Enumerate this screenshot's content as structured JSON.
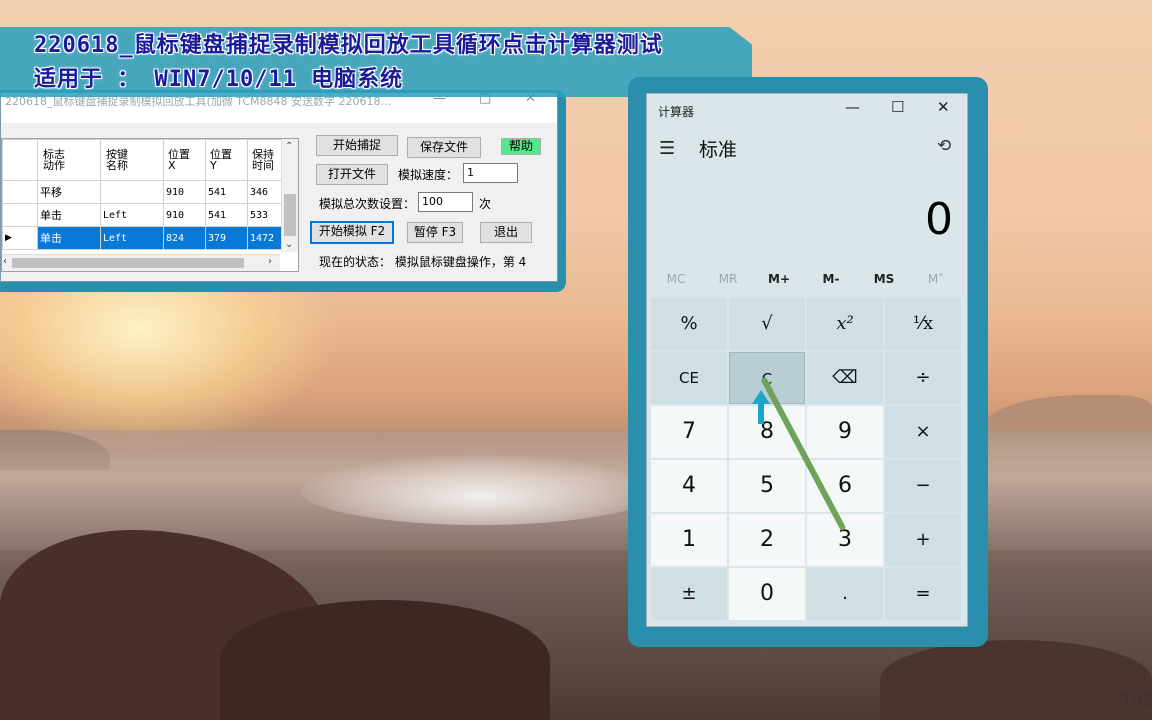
{
  "banner": {
    "line1": "220618_鼠标键盘捕捉录制模拟回放工具循环点击计算器测试",
    "line2": "适用于 ： WIN7/10/11 电脑系统"
  },
  "recorder": {
    "title": "220618_鼠标键盘捕捉录制模拟回放工具(加微 TCM8848 安送数字 220618...",
    "title_controls": [
      "—",
      "□",
      "✕"
    ],
    "headers": [
      "",
      "标志\n动作",
      "按键\n名称",
      "位置\nX",
      "位置\nY",
      "保持\n时间"
    ],
    "rows": [
      {
        "action": "平移",
        "key": "",
        "x": "910",
        "y": "541",
        "hold": "346"
      },
      {
        "action": "单击",
        "key": "Left",
        "x": "910",
        "y": "541",
        "hold": "533"
      },
      {
        "action": "单击",
        "key": "Left",
        "x": "824",
        "y": "379",
        "hold": "1472"
      }
    ],
    "buttons": {
      "start_capture": "开始捕捉",
      "save_file": "保存文件",
      "help": "帮助",
      "open_file": "打开文件",
      "start_sim": "开始模拟 F2",
      "pause": "暂停 F3",
      "exit": "退出"
    },
    "speed_label": "模拟速度：",
    "speed_value": "1",
    "total_label": "模拟总次数设置：",
    "total_value": "100",
    "total_unit": "次",
    "status": "现在的状态：  模拟鼠标键盘操作，第 4"
  },
  "calculator": {
    "app_title": "计算器",
    "window_controls": [
      "—",
      "☐",
      "✕"
    ],
    "mode": "标准",
    "display": "0",
    "memory": [
      "MC",
      "MR",
      "M+",
      "M-",
      "MS",
      "M˅"
    ],
    "keys": [
      [
        "%",
        "√",
        "x²",
        "¹⁄x"
      ],
      [
        "CE",
        "C",
        "⌫",
        "÷"
      ],
      [
        "7",
        "8",
        "9",
        "×"
      ],
      [
        "4",
        "5",
        "6",
        "−"
      ],
      [
        "1",
        "2",
        "3",
        "+"
      ],
      [
        "±",
        "0",
        ".",
        "="
      ]
    ]
  },
  "page_number": "152"
}
